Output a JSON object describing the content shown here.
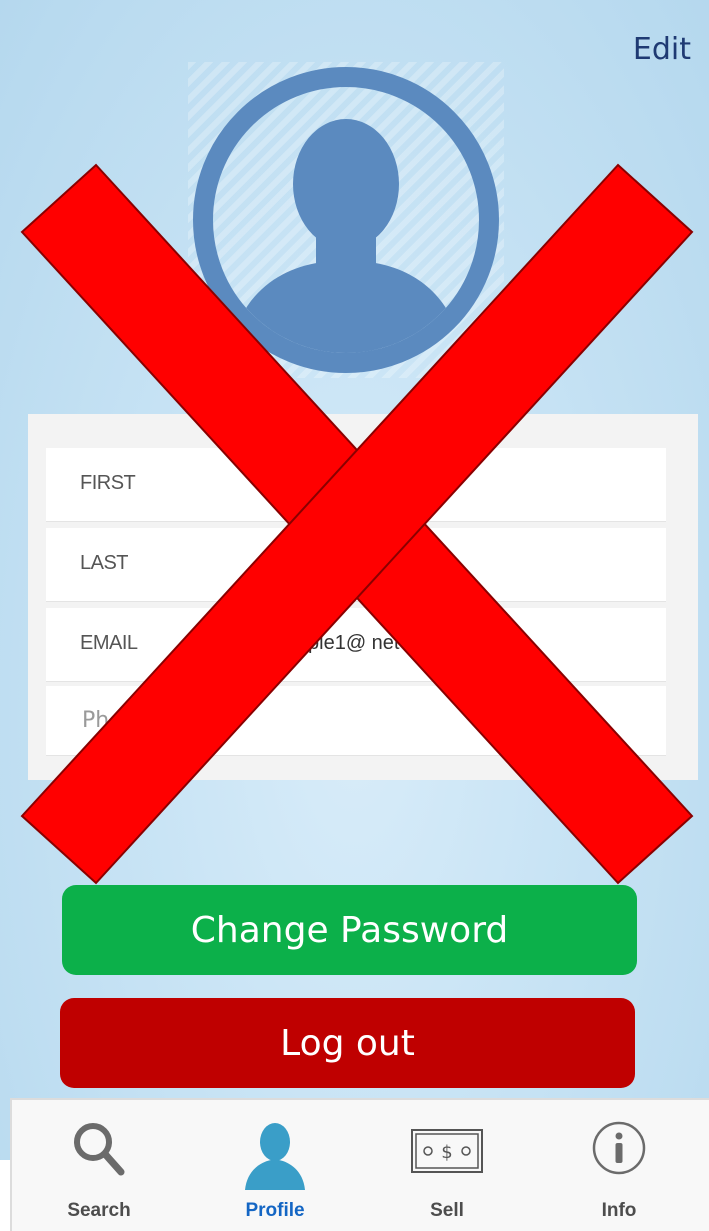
{
  "header": {
    "edit_label": "Edit"
  },
  "avatar": {
    "icon": "user-silhouette-icon",
    "color": "#5b8abf"
  },
  "form": {
    "rows": [
      {
        "label": "FIRST",
        "value": ""
      },
      {
        "label": "LAST",
        "value": "T"
      },
      {
        "label": "EMAIL",
        "value": "ple1@ net"
      },
      {
        "label": "",
        "placeholder": "Pho"
      }
    ]
  },
  "buttons": {
    "change_password_label": "Change Password",
    "change_password_color": "#0cb04a",
    "logout_label": "Log out",
    "logout_color": "#bf0000"
  },
  "overlay": {
    "mark": "red-x-cross",
    "color": "#ff0000"
  },
  "tabbar": {
    "tabs": [
      {
        "label": "Search",
        "icon": "search-icon",
        "active": false
      },
      {
        "label": "Profile",
        "icon": "profile-icon",
        "active": true
      },
      {
        "label": "Sell",
        "icon": "money-bill-icon",
        "active": false
      },
      {
        "label": "Info",
        "icon": "info-icon",
        "active": false
      }
    ],
    "active_color": "#1466c4"
  }
}
